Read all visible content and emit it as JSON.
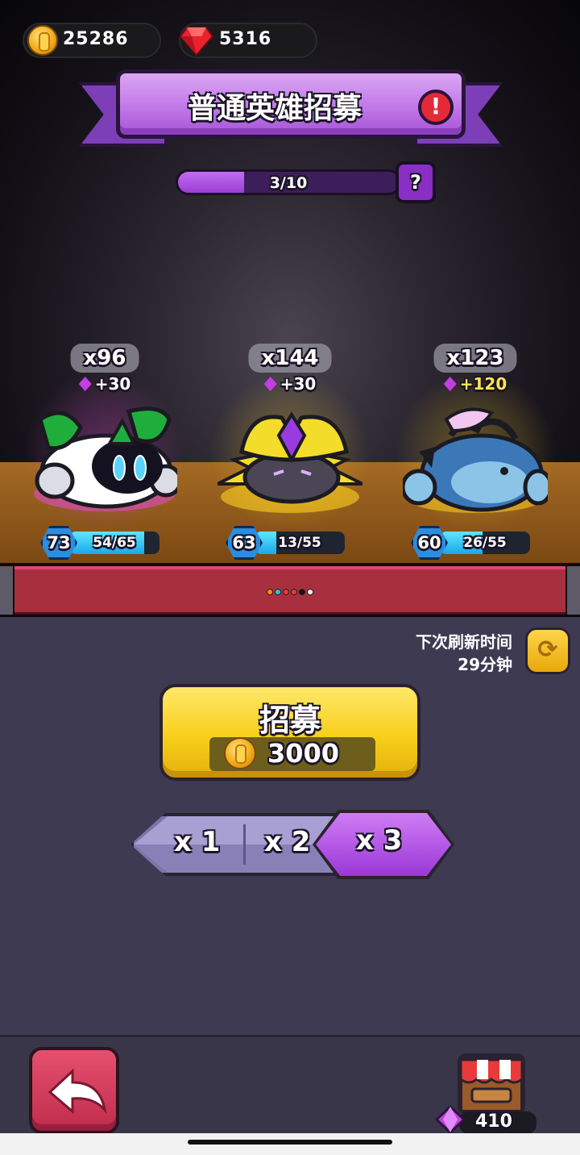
{
  "currency": {
    "coins": "25286",
    "gems": "5316"
  },
  "banner": {
    "title": "普通英雄招募",
    "alert_icon": "exclamation-icon"
  },
  "progress": {
    "text": "3/10",
    "current": 3,
    "total": 10,
    "help_label": "?"
  },
  "heroes": [
    {
      "count": "x96",
      "bonus": "+30",
      "level": "73",
      "xp": "54/65",
      "xp_fraction": 0.83,
      "glow_color": "#e64bd6",
      "body_color": "#ffffff",
      "accent": "#1fae3b"
    },
    {
      "count": "x144",
      "bonus": "+30",
      "level": "63",
      "xp": "13/55",
      "xp_fraction": 0.24,
      "glow_color": "#ffd21f",
      "body_color": "#f4dc2a",
      "accent": "#9a3be0"
    },
    {
      "count": "x123",
      "bonus": "+120",
      "level": "60",
      "xp": "26/55",
      "xp_fraction": 0.47,
      "glow_color": "#ffd21f",
      "body_color": "#3c78b8",
      "accent": "#1c1a2a"
    }
  ],
  "page_dots": [
    "#ff8a1a",
    "#2bc4e8",
    "#e83a3a",
    "#e83a3a",
    "#111111",
    "#ffffff"
  ],
  "refresh": {
    "label_line1": "下次刷新时间",
    "label_line2": "29分钟"
  },
  "recruit": {
    "label": "招募",
    "cost": "3000"
  },
  "multiplier": {
    "options": [
      "x 1",
      "x 2",
      "x 3"
    ],
    "selected": "x 3"
  },
  "shop": {
    "price": "410"
  },
  "colors": {
    "accent_purple": "#b865e6",
    "gold": "#f7cf1a",
    "back_red": "#d63c5c"
  }
}
